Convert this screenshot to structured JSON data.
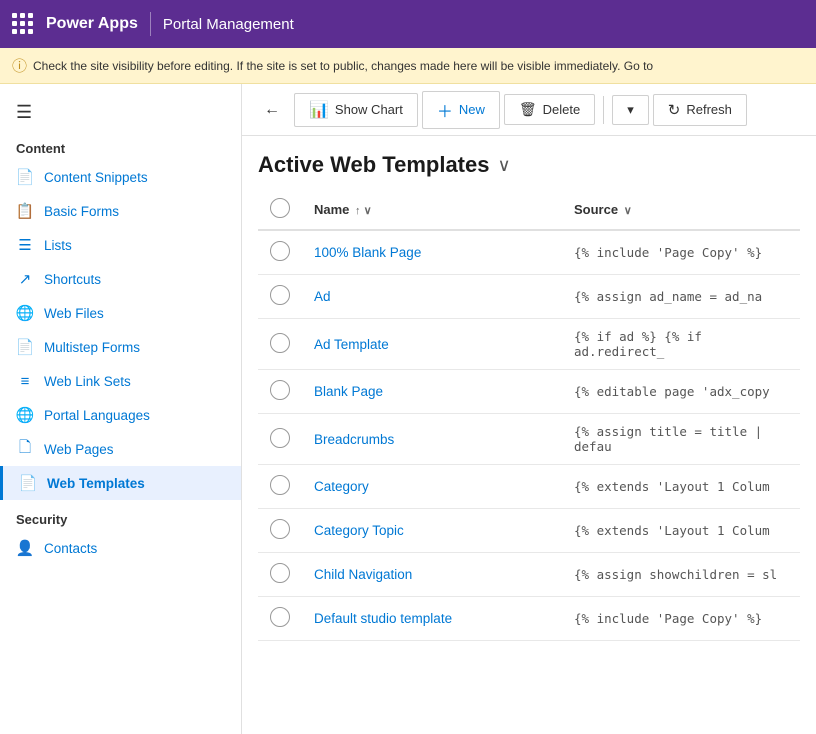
{
  "topbar": {
    "app_name": "Power Apps",
    "portal_name": "Portal Management"
  },
  "warning": {
    "text": "Check the site visibility before editing. If the site is set to public, changes made here will be visible immediately. Go to"
  },
  "toolbar": {
    "back_icon": "←",
    "show_chart_label": "Show Chart",
    "new_label": "New",
    "delete_label": "Delete",
    "chevron_label": "▾",
    "refresh_label": "Refresh"
  },
  "table": {
    "title": "Active Web Templates",
    "title_chevron": "∨",
    "columns": [
      {
        "key": "name",
        "label": "Name",
        "sort": "↑ ∨"
      },
      {
        "key": "source",
        "label": "Source",
        "sort": "∨"
      }
    ],
    "rows": [
      {
        "name": "100% Blank Page",
        "source": "{% include 'Page Copy' %}"
      },
      {
        "name": "Ad",
        "source": "{% assign ad_name = ad_na"
      },
      {
        "name": "Ad Template",
        "source": "{% if ad %} {% if ad.redirect_"
      },
      {
        "name": "Blank Page",
        "source": "{% editable page 'adx_copy"
      },
      {
        "name": "Breadcrumbs",
        "source": "{% assign title = title | defau"
      },
      {
        "name": "Category",
        "source": "{% extends 'Layout 1 Colum"
      },
      {
        "name": "Category Topic",
        "source": "{% extends 'Layout 1 Colum"
      },
      {
        "name": "Child Navigation",
        "source": "{% assign showchildren = sl"
      },
      {
        "name": "Default studio template",
        "source": "{% include 'Page Copy' %}"
      }
    ]
  },
  "sidebar": {
    "content_title": "Content",
    "security_title": "Security",
    "items": [
      {
        "label": "Content Snippets",
        "icon": "📄"
      },
      {
        "label": "Basic Forms",
        "icon": "📋"
      },
      {
        "label": "Lists",
        "icon": "☰"
      },
      {
        "label": "Shortcuts",
        "icon": "↗"
      },
      {
        "label": "Web Files",
        "icon": "🌐"
      },
      {
        "label": "Multistep Forms",
        "icon": "📄"
      },
      {
        "label": "Web Link Sets",
        "icon": "≡"
      },
      {
        "label": "Portal Languages",
        "icon": "🌐"
      },
      {
        "label": "Web Pages",
        "icon": "🗋"
      },
      {
        "label": "Web Templates",
        "icon": "📄"
      }
    ],
    "security_items": [
      {
        "label": "Contacts",
        "icon": "👤"
      }
    ]
  }
}
